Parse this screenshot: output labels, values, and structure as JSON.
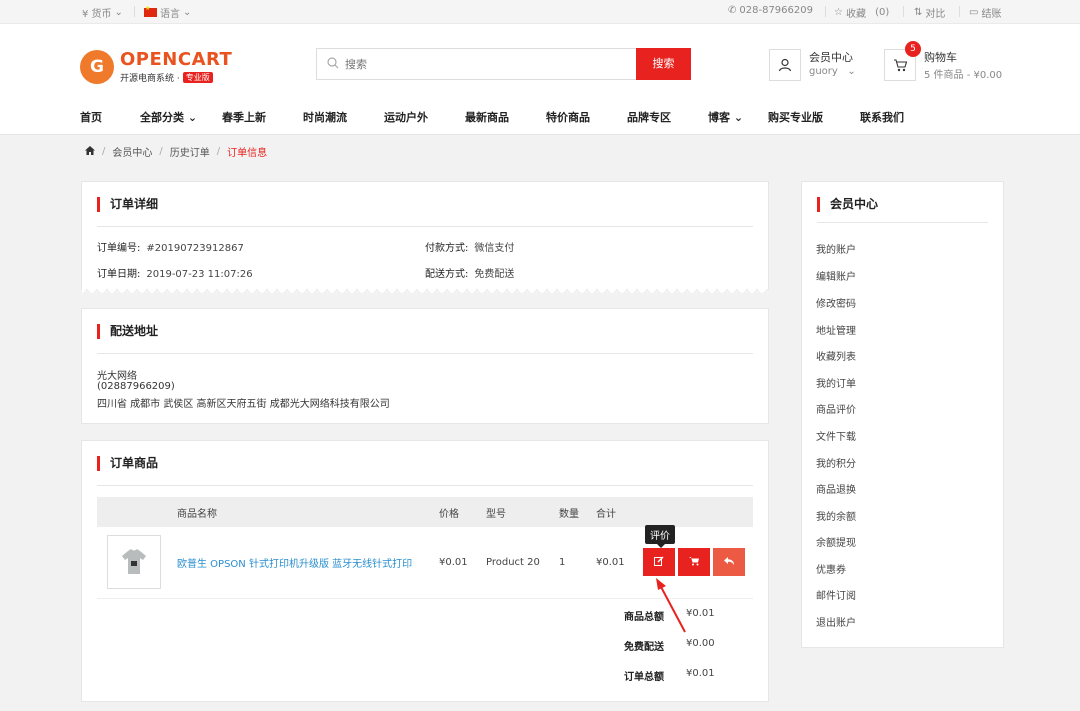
{
  "topbar": {
    "currency": "¥ 货币",
    "language": "语言",
    "phone": "028-87966209",
    "favorites": "收藏",
    "favorites_count": "(0)",
    "compare": "对比",
    "checkout": "结账"
  },
  "header": {
    "logo_mark": "G",
    "logo_text": "OPENCART",
    "logo_sub": "开源电商系统 ·",
    "logo_badge": "专业版",
    "search_placeholder": "搜索",
    "search_button": "搜索",
    "account_title": "会员中心",
    "account_user": "guory",
    "cart_title": "购物车",
    "cart_summary": "5 件商品 - ¥0.00",
    "cart_count": "5"
  },
  "nav": [
    {
      "label": "首页"
    },
    {
      "label": "全部分类 ⌄"
    },
    {
      "label": "春季上新"
    },
    {
      "label": "时尚潮流"
    },
    {
      "label": "运动户外"
    },
    {
      "label": "最新商品"
    },
    {
      "label": "特价商品"
    },
    {
      "label": "品牌专区"
    },
    {
      "label": "博客 ⌄"
    },
    {
      "label": "购买专业版"
    },
    {
      "label": "联系我们"
    }
  ],
  "breadcrumb": {
    "home_icon": "home-icon",
    "items": [
      "会员中心",
      "历史订单",
      "订单信息"
    ]
  },
  "order_detail": {
    "title": "订单详细",
    "order_no_label": "订单编号:",
    "order_no": "#20190723912867",
    "order_date_label": "订单日期:",
    "order_date": "2019-07-23 11:07:26",
    "payment_label": "付款方式:",
    "payment": "微信支付",
    "shipping_label": "配送方式:",
    "shipping": "免费配送"
  },
  "shipping_address": {
    "title": "配送地址",
    "lines": [
      "光大网络",
      "(02887966209)",
      "四川省 成都市 武侯区 高新区天府五街 成都光大网络科技有限公司"
    ]
  },
  "order_products": {
    "title": "订单商品",
    "columns": {
      "name": "商品名称",
      "price": "价格",
      "model": "型号",
      "qty": "数量",
      "total": "合计"
    },
    "rows": [
      {
        "name": "欧普生 OPSON 针式打印机升级版 蓝牙无线针式打印",
        "price": "¥0.01",
        "model": "Product 20",
        "qty": "1",
        "total": "¥0.01"
      }
    ],
    "tooltip": "评价",
    "totals": [
      {
        "label": "商品总额",
        "value": "¥0.01"
      },
      {
        "label": "免费配送",
        "value": "¥0.00"
      },
      {
        "label": "订单总额",
        "value": "¥0.01"
      }
    ]
  },
  "sidebar": {
    "title": "会员中心",
    "items": [
      "我的账户",
      "编辑账户",
      "修改密码",
      "地址管理",
      "收藏列表",
      "我的订单",
      "商品评价",
      "文件下载",
      "我的积分",
      "商品退换",
      "我的余额",
      "余额提现",
      "优惠券",
      "邮件订阅",
      "退出账户"
    ]
  },
  "colors": {
    "accent": "#e8231f",
    "link": "#2a8fd0",
    "logo": "#ef7a2b"
  }
}
